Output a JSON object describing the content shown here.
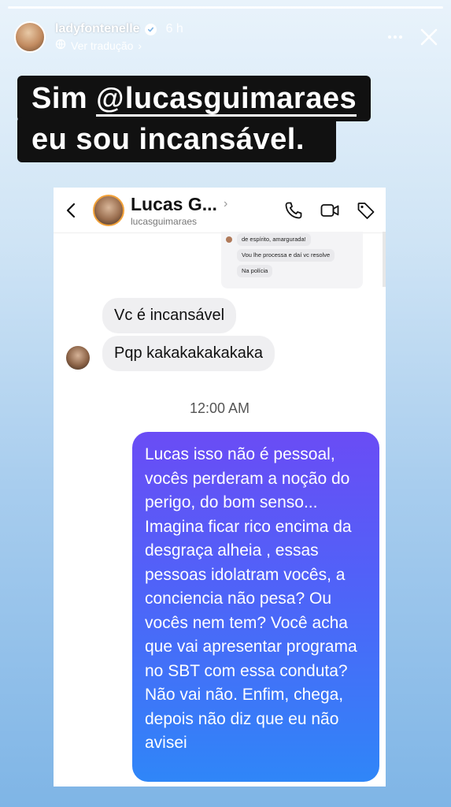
{
  "story": {
    "username": "ladyfontenelle",
    "time": "6 h",
    "translate_label": "Ver tradução"
  },
  "caption": {
    "line1_prefix": "Sim ",
    "mention": "lucasguimaraes",
    "line2": "eu sou incansável."
  },
  "dm": {
    "contact_name": "Lucas G...",
    "contact_handle": "lucasguimaraes",
    "mini_shot": {
      "msg1": "de espírito, amargurada!",
      "msg2": "Vou lhe processa e daí vc resolve",
      "msg3": "Na polícia"
    },
    "received": [
      "Vc é incansável",
      "Pqp kakakakakakaka"
    ],
    "timestamp": "12:00 AM",
    "sent": "Lucas isso não é pessoal, vocês perderam a noção do perigo, do bom senso... Imagina ficar rico encima da desgraça alheia , essas pessoas idolatram vocês, a conciencia não pesa? Ou vocês nem tem? Você acha que vai apresentar programa no SBT com essa conduta? Não vai não. Enfim, chega, depois não diz que eu não avisei"
  },
  "icons": {
    "verified": "verified-badge-icon",
    "more": "more-horizontal-icon",
    "close": "close-icon",
    "back": "chevron-left-icon",
    "call": "phone-icon",
    "video": "video-icon",
    "tag": "tag-icon",
    "threads": "threads-icon"
  }
}
